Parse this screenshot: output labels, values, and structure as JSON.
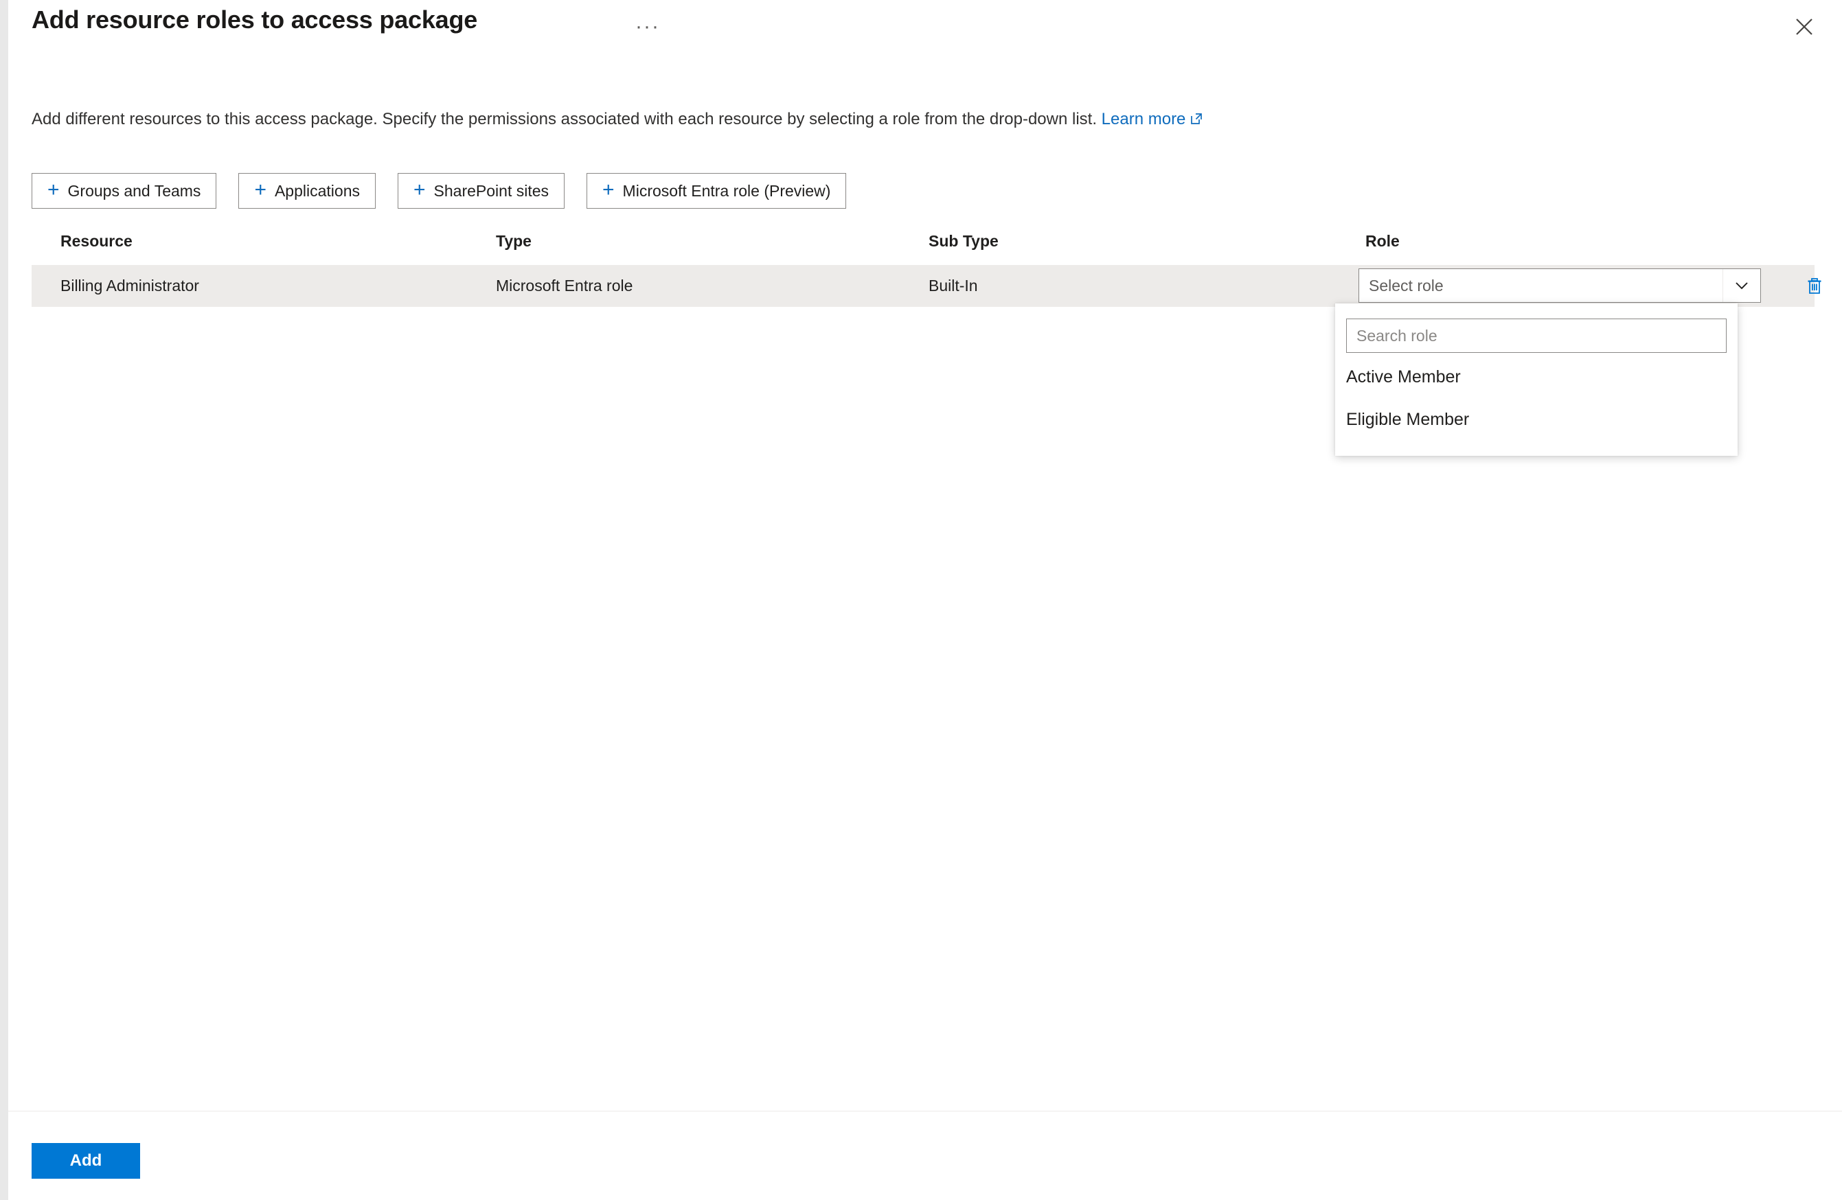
{
  "header": {
    "title": "Add resource roles to access package",
    "ellipsis_label": "···",
    "close_icon": "close-icon"
  },
  "description": {
    "text": "Add different resources to this access package. Specify the permissions associated with each resource by selecting a role from the drop-down list.",
    "link_label": "Learn more",
    "link_icon": "external-link-icon"
  },
  "commands": [
    {
      "label": "Groups and Teams",
      "icon": "plus-icon"
    },
    {
      "label": "Applications",
      "icon": "plus-icon"
    },
    {
      "label": "SharePoint sites",
      "icon": "plus-icon"
    },
    {
      "label": "Microsoft Entra role (Preview)",
      "icon": "plus-icon"
    }
  ],
  "table": {
    "columns": [
      "Resource",
      "Type",
      "Sub Type",
      "Role"
    ],
    "rows": [
      {
        "resource": "Billing Administrator",
        "type": "Microsoft Entra role",
        "sub_type": "Built-In",
        "role_placeholder": "Select role",
        "delete_icon": "trash-icon"
      }
    ]
  },
  "role_dropdown": {
    "open": true,
    "search_placeholder": "Search role",
    "search_value": "",
    "options": [
      "Active Member",
      "Eligible Member"
    ]
  },
  "footer": {
    "add_label": "Add"
  },
  "colors": {
    "accent": "#0078d4",
    "link": "#0f6cbd",
    "row_bg": "#edebe9",
    "border": "#8a8886",
    "text": "#201f1e"
  }
}
